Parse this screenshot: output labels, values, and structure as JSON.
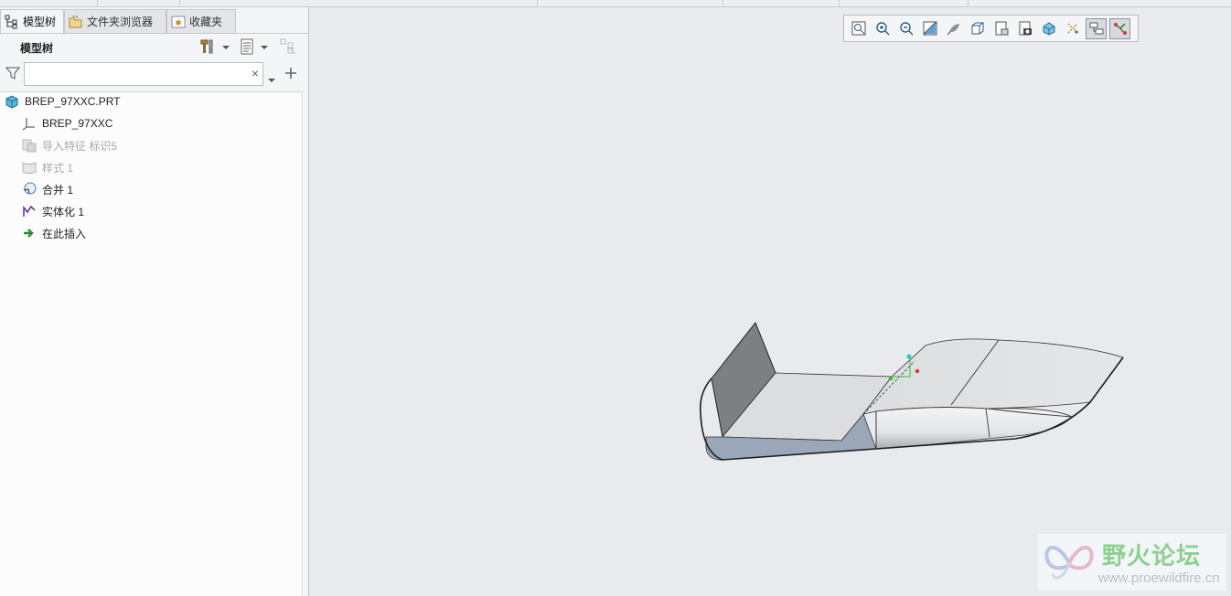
{
  "tabs": [
    {
      "label": "模型树",
      "icon": "model-tree-icon",
      "active": true
    },
    {
      "label": "文件夹浏览器",
      "icon": "folder-browser-icon",
      "active": false
    },
    {
      "label": "收藏夹",
      "icon": "favorites-icon",
      "active": false
    }
  ],
  "panel": {
    "title": "模型树",
    "search_value": "",
    "search_clear": "×"
  },
  "tree": {
    "items": [
      {
        "label": "BREP_97XXC.PRT",
        "icon": "part-cube-icon",
        "dim": false
      },
      {
        "label": "BREP_97XXC",
        "icon": "coordinate-system-icon",
        "dim": false
      },
      {
        "label": "导入特征 标识5",
        "icon": "import-feature-icon",
        "dim": true
      },
      {
        "label": "样式 1",
        "icon": "style-feature-icon",
        "dim": true
      },
      {
        "label": "合并 1",
        "icon": "merge-icon",
        "dim": false
      },
      {
        "label": "实体化 1",
        "icon": "solidify-icon",
        "dim": false
      },
      {
        "label": "在此插入",
        "icon": "insert-here-arrow-icon",
        "dim": false
      }
    ]
  },
  "view_toolbar": {
    "buttons": [
      "refit-icon",
      "zoom-in-icon",
      "zoom-out-icon",
      "repaint-icon",
      "display-style-icon",
      "saved-orientations-icon",
      "view-manager-icon",
      "perspective-icon",
      "section-icon",
      "datum-display-icon",
      "annotation-display-icon",
      "spin-center-icon"
    ]
  },
  "watermark": {
    "cn": "野火论坛",
    "url": "www.proewildfire.cn"
  },
  "colors": {
    "viewport_bg": "#e8eaee",
    "panel_bg": "#f4f5f7",
    "model_face": "#d9dadc",
    "model_dark": "#7d7f82",
    "model_blue": "#9aa7b8"
  }
}
